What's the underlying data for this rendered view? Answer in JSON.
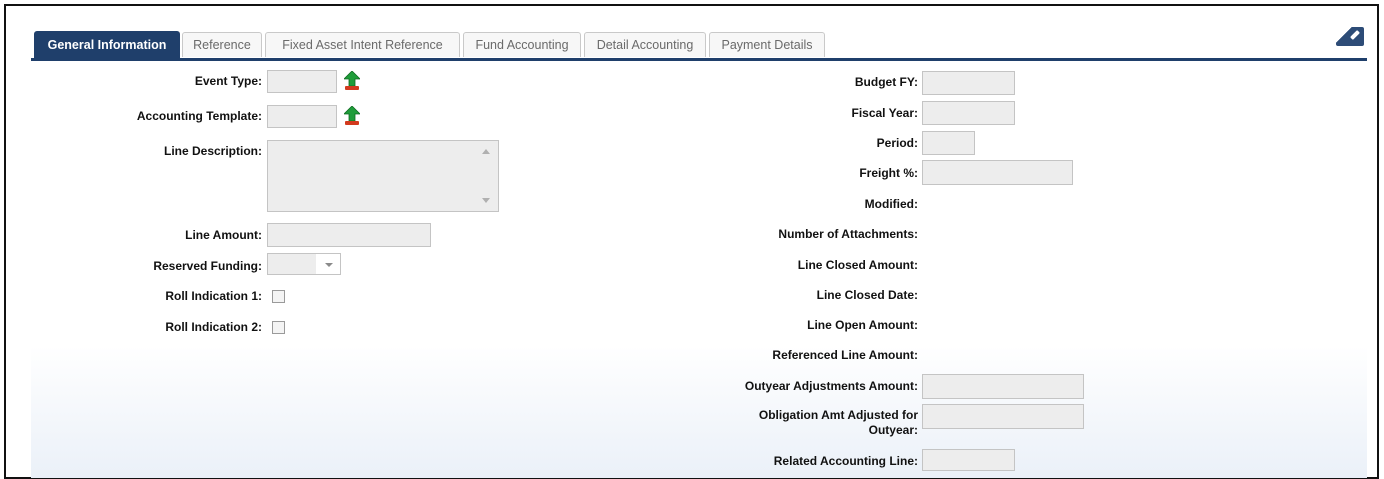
{
  "tabs": [
    {
      "label": "General Information",
      "active": true
    },
    {
      "label": "Reference",
      "active": false
    },
    {
      "label": "Fixed Asset Intent Reference",
      "active": false
    },
    {
      "label": "Fund Accounting",
      "active": false
    },
    {
      "label": "Detail Accounting",
      "active": false
    },
    {
      "label": "Payment Details",
      "active": false
    }
  ],
  "left_fields": {
    "event_type": {
      "label": "Event Type:",
      "value": ""
    },
    "accounting_template": {
      "label": "Accounting Template:",
      "value": ""
    },
    "line_description": {
      "label": "Line Description:",
      "value": ""
    },
    "line_amount": {
      "label": "Line Amount:",
      "value": ""
    },
    "reserved_funding": {
      "label": "Reserved Funding:",
      "value": ""
    },
    "roll_indication_1": {
      "label": "Roll Indication 1:",
      "checked": false
    },
    "roll_indication_2": {
      "label": "Roll Indication 2:",
      "checked": false
    }
  },
  "right_fields": {
    "budget_fy": {
      "label": "Budget FY:",
      "value": ""
    },
    "fiscal_year": {
      "label": "Fiscal Year:",
      "value": ""
    },
    "period": {
      "label": "Period:",
      "value": ""
    },
    "freight_pct": {
      "label": "Freight %:",
      "value": ""
    },
    "modified": {
      "label": "Modified:",
      "value": ""
    },
    "number_of_attachments": {
      "label": "Number of Attachments:",
      "value": ""
    },
    "line_closed_amount": {
      "label": "Line Closed Amount:",
      "value": ""
    },
    "line_closed_date": {
      "label": "Line Closed Date:",
      "value": ""
    },
    "line_open_amount": {
      "label": "Line Open Amount:",
      "value": ""
    },
    "referenced_line_amount": {
      "label": "Referenced Line Amount:",
      "value": ""
    },
    "outyear_adjustments_amount": {
      "label": "Outyear Adjustments Amount:",
      "value": ""
    },
    "obligation_amt_adjusted": {
      "label_line1": "Obligation Amt Adjusted for",
      "label_line2": "Outyear:",
      "value": ""
    },
    "related_accounting_line": {
      "label": "Related Accounting Line:",
      "value": ""
    }
  },
  "icons": {
    "lookup": "lookup-arrow-icon",
    "pin": "pin-icon"
  },
  "colors": {
    "active_tab": "#1f3f6b",
    "input_bg": "#ededed",
    "lookup_green": "#1f9d3a",
    "lookup_red": "#d23a1e"
  }
}
